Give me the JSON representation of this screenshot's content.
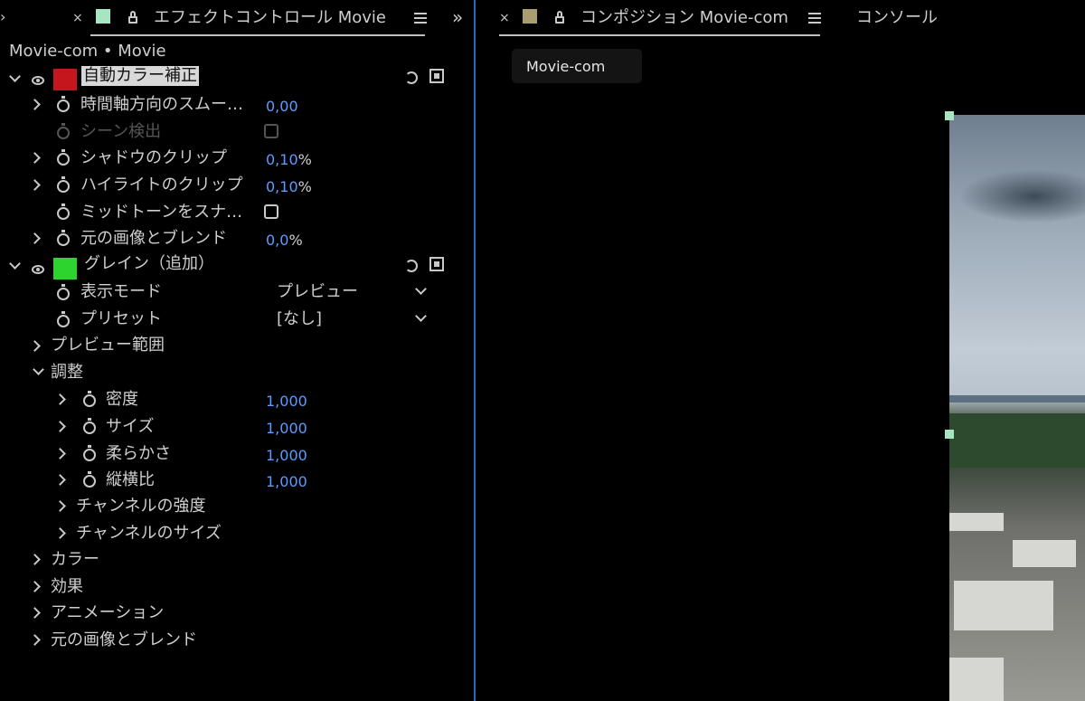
{
  "effect_panel": {
    "tab_title": "エフェクトコントロール Movie",
    "breadcrumb": "Movie-com • Movie",
    "colors": {
      "swatch_red": "#c4161c",
      "swatch_green": "#2ed42e",
      "tab_swatch": "#a8e6c2",
      "value_blue": "#5b9cff",
      "panel_border": "#2f63c0"
    },
    "effects": [
      {
        "name": "自動カラー補正",
        "expanded": true
      },
      {
        "name": "グレイン（追加）",
        "expanded": true
      }
    ],
    "auto_color": {
      "temporal_smoothing": {
        "label": "時間軸方向のスムー…",
        "value": "0,00"
      },
      "scene_detect": {
        "label": "シーン検出"
      },
      "black_clip": {
        "label": "シャドウのクリップ",
        "value": "0,10",
        "unit": "%"
      },
      "white_clip": {
        "label": "ハイライトのクリップ",
        "value": "0,10",
        "unit": "%"
      },
      "snap_midtones": {
        "label": "ミッドトーンをスナ…"
      },
      "blend": {
        "label": "元の画像とブレンド",
        "value": "0,0",
        "unit": "%"
      }
    },
    "grain": {
      "view_mode": {
        "label": "表示モード",
        "value": "プレビュー"
      },
      "preset": {
        "label": "プリセット",
        "value": "[なし]"
      },
      "preview_region": "プレビュー範囲",
      "tweaking": "調整",
      "intensity": {
        "label": "密度",
        "value": "1,000"
      },
      "size": {
        "label": "サイズ",
        "value": "1,000"
      },
      "softness": {
        "label": "柔らかさ",
        "value": "1,000"
      },
      "aspect_ratio": {
        "label": "縦横比",
        "value": "1,000"
      },
      "channel_intensity": "チャンネルの強度",
      "channel_size": "チャンネルのサイズ",
      "color": "カラー",
      "application": "効果",
      "animation": "アニメーション",
      "blend": "元の画像とブレンド"
    }
  },
  "comp_panel": {
    "tab_title": "コンポジション Movie-com",
    "console_tab": "コンソール",
    "active_comp": "Movie-com",
    "tab_swatch": "#a89e70"
  }
}
